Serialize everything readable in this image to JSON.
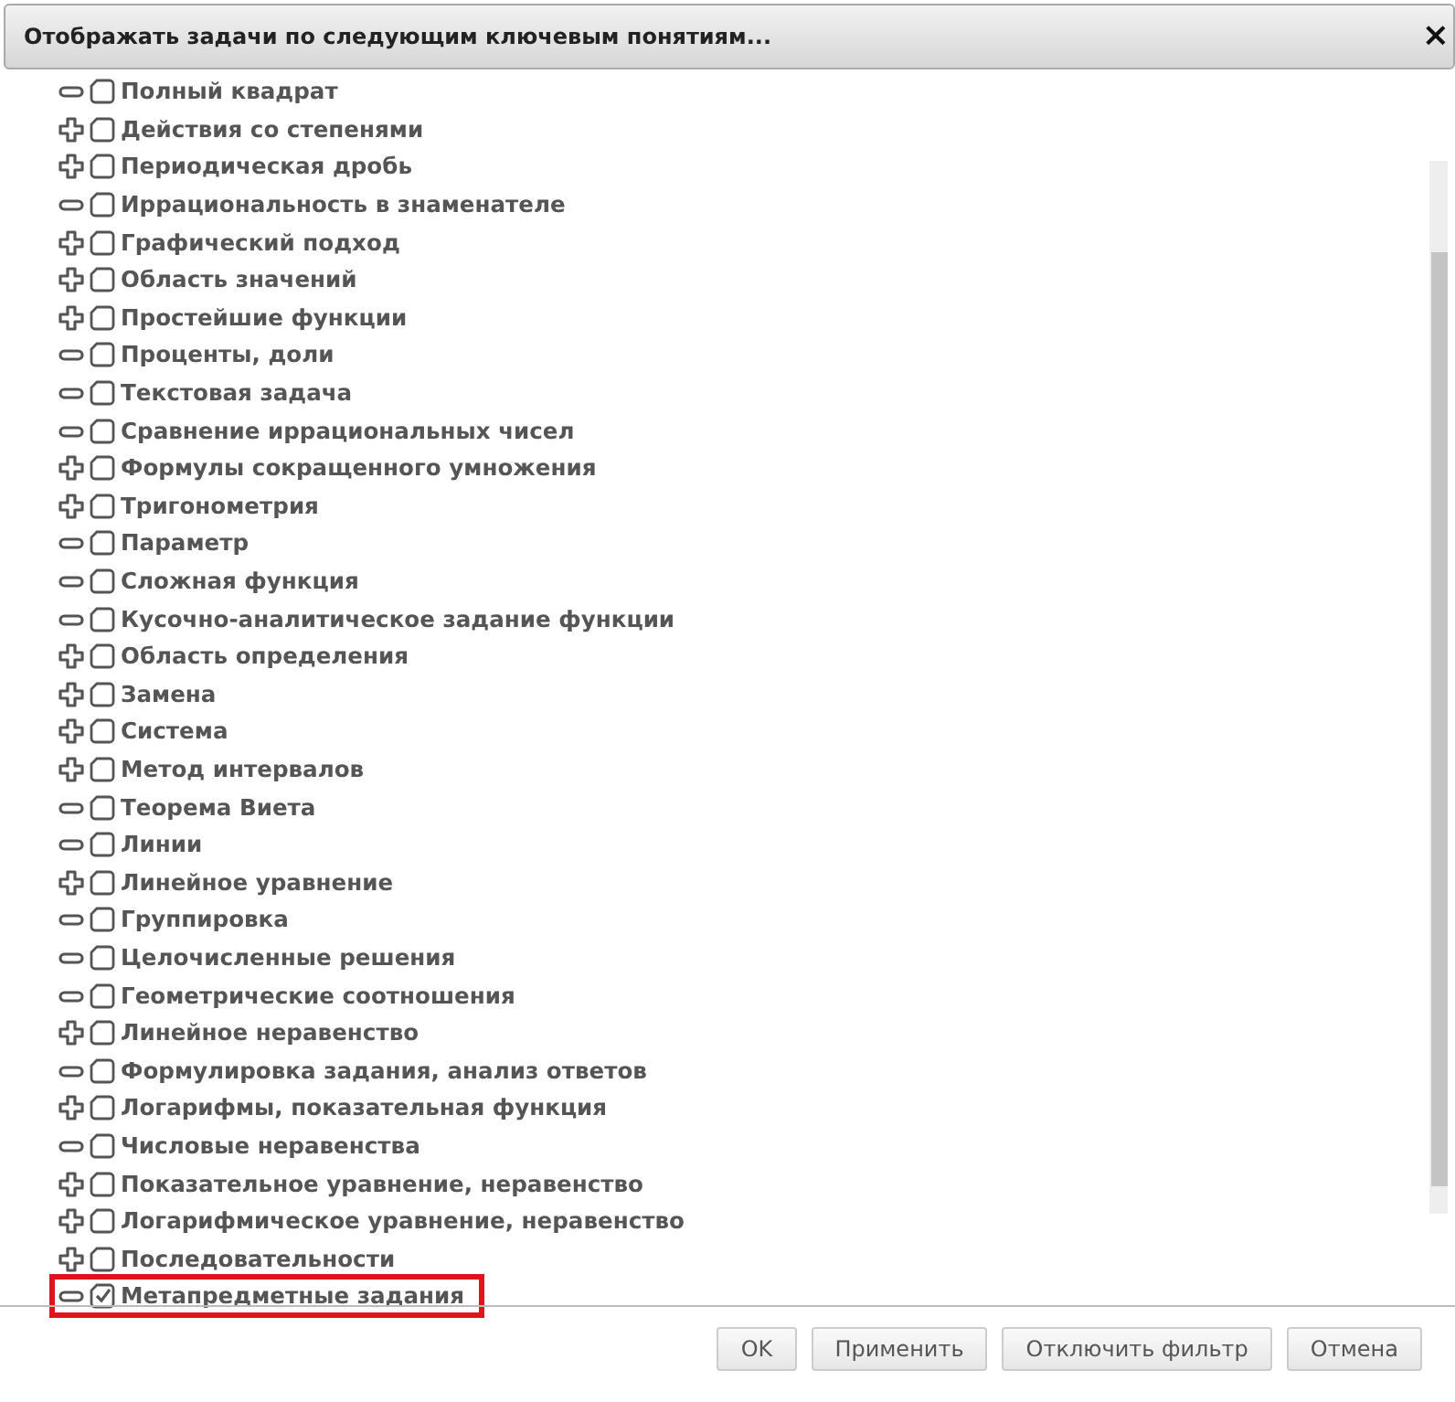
{
  "dialog": {
    "title": "Отображать задачи по следующим ключевым понятиям...",
    "close": "×"
  },
  "tree": {
    "items": [
      {
        "label": "Полный квадрат",
        "kind": "leaf",
        "checked": false,
        "highlighted": false
      },
      {
        "label": "Действия со степенями",
        "kind": "group",
        "checked": false,
        "highlighted": false
      },
      {
        "label": "Периодическая дробь",
        "kind": "group",
        "checked": false,
        "highlighted": false
      },
      {
        "label": "Иррациональность в знаменателе",
        "kind": "leaf",
        "checked": false,
        "highlighted": false
      },
      {
        "label": "Графический подход",
        "kind": "group",
        "checked": false,
        "highlighted": false
      },
      {
        "label": "Область значений",
        "kind": "group",
        "checked": false,
        "highlighted": false
      },
      {
        "label": "Простейшие функции",
        "kind": "group",
        "checked": false,
        "highlighted": false
      },
      {
        "label": "Проценты, доли",
        "kind": "leaf",
        "checked": false,
        "highlighted": false
      },
      {
        "label": "Текстовая задача",
        "kind": "leaf",
        "checked": false,
        "highlighted": false
      },
      {
        "label": "Сравнение иррациональных чисел",
        "kind": "leaf",
        "checked": false,
        "highlighted": false
      },
      {
        "label": "Формулы сокращенного умножения",
        "kind": "group",
        "checked": false,
        "highlighted": false
      },
      {
        "label": "Тригонометрия",
        "kind": "group",
        "checked": false,
        "highlighted": false
      },
      {
        "label": "Параметр",
        "kind": "leaf",
        "checked": false,
        "highlighted": false
      },
      {
        "label": "Сложная функция",
        "kind": "leaf",
        "checked": false,
        "highlighted": false
      },
      {
        "label": "Кусочно-аналитическое задание функции",
        "kind": "leaf",
        "checked": false,
        "highlighted": false
      },
      {
        "label": "Область определения",
        "kind": "group",
        "checked": false,
        "highlighted": false
      },
      {
        "label": "Замена",
        "kind": "group",
        "checked": false,
        "highlighted": false
      },
      {
        "label": "Система",
        "kind": "group",
        "checked": false,
        "highlighted": false
      },
      {
        "label": "Метод интервалов",
        "kind": "group",
        "checked": false,
        "highlighted": false
      },
      {
        "label": "Теорема Виета",
        "kind": "leaf",
        "checked": false,
        "highlighted": false
      },
      {
        "label": "Линии",
        "kind": "leaf",
        "checked": false,
        "highlighted": false
      },
      {
        "label": "Линейное уравнение",
        "kind": "group",
        "checked": false,
        "highlighted": false
      },
      {
        "label": "Группировка",
        "kind": "leaf",
        "checked": false,
        "highlighted": false
      },
      {
        "label": "Целочисленные решения",
        "kind": "leaf",
        "checked": false,
        "highlighted": false
      },
      {
        "label": "Геометрические соотношения",
        "kind": "leaf",
        "checked": false,
        "highlighted": false
      },
      {
        "label": "Линейное неравенство",
        "kind": "group",
        "checked": false,
        "highlighted": false
      },
      {
        "label": "Формулировка задания, анализ ответов",
        "kind": "leaf",
        "checked": false,
        "highlighted": false
      },
      {
        "label": "Логарифмы, показательная функция",
        "kind": "group",
        "checked": false,
        "highlighted": false
      },
      {
        "label": "Числовые неравенства",
        "kind": "leaf",
        "checked": false,
        "highlighted": false
      },
      {
        "label": "Показательное уравнение, неравенство",
        "kind": "group",
        "checked": false,
        "highlighted": false
      },
      {
        "label": "Логарифмическое уравнение, неравенство",
        "kind": "group",
        "checked": false,
        "highlighted": false
      },
      {
        "label": "Последовательности",
        "kind": "group",
        "checked": false,
        "highlighted": false
      },
      {
        "label": "Метапредметные задания",
        "kind": "leaf",
        "checked": true,
        "highlighted": true
      }
    ]
  },
  "buttons": [
    "OK",
    "Применить",
    "Отключить фильтр",
    "Отмена"
  ]
}
